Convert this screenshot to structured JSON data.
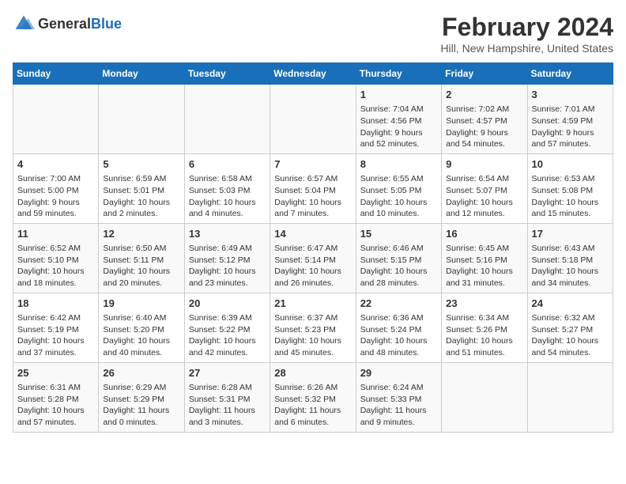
{
  "header": {
    "logo_general": "General",
    "logo_blue": "Blue",
    "title": "February 2024",
    "subtitle": "Hill, New Hampshire, United States"
  },
  "days_of_week": [
    "Sunday",
    "Monday",
    "Tuesday",
    "Wednesday",
    "Thursday",
    "Friday",
    "Saturday"
  ],
  "weeks": [
    [
      {
        "num": "",
        "detail": ""
      },
      {
        "num": "",
        "detail": ""
      },
      {
        "num": "",
        "detail": ""
      },
      {
        "num": "",
        "detail": ""
      },
      {
        "num": "1",
        "detail": "Sunrise: 7:04 AM\nSunset: 4:56 PM\nDaylight: 9 hours\nand 52 minutes."
      },
      {
        "num": "2",
        "detail": "Sunrise: 7:02 AM\nSunset: 4:57 PM\nDaylight: 9 hours\nand 54 minutes."
      },
      {
        "num": "3",
        "detail": "Sunrise: 7:01 AM\nSunset: 4:59 PM\nDaylight: 9 hours\nand 57 minutes."
      }
    ],
    [
      {
        "num": "4",
        "detail": "Sunrise: 7:00 AM\nSunset: 5:00 PM\nDaylight: 9 hours\nand 59 minutes."
      },
      {
        "num": "5",
        "detail": "Sunrise: 6:59 AM\nSunset: 5:01 PM\nDaylight: 10 hours\nand 2 minutes."
      },
      {
        "num": "6",
        "detail": "Sunrise: 6:58 AM\nSunset: 5:03 PM\nDaylight: 10 hours\nand 4 minutes."
      },
      {
        "num": "7",
        "detail": "Sunrise: 6:57 AM\nSunset: 5:04 PM\nDaylight: 10 hours\nand 7 minutes."
      },
      {
        "num": "8",
        "detail": "Sunrise: 6:55 AM\nSunset: 5:05 PM\nDaylight: 10 hours\nand 10 minutes."
      },
      {
        "num": "9",
        "detail": "Sunrise: 6:54 AM\nSunset: 5:07 PM\nDaylight: 10 hours\nand 12 minutes."
      },
      {
        "num": "10",
        "detail": "Sunrise: 6:53 AM\nSunset: 5:08 PM\nDaylight: 10 hours\nand 15 minutes."
      }
    ],
    [
      {
        "num": "11",
        "detail": "Sunrise: 6:52 AM\nSunset: 5:10 PM\nDaylight: 10 hours\nand 18 minutes."
      },
      {
        "num": "12",
        "detail": "Sunrise: 6:50 AM\nSunset: 5:11 PM\nDaylight: 10 hours\nand 20 minutes."
      },
      {
        "num": "13",
        "detail": "Sunrise: 6:49 AM\nSunset: 5:12 PM\nDaylight: 10 hours\nand 23 minutes."
      },
      {
        "num": "14",
        "detail": "Sunrise: 6:47 AM\nSunset: 5:14 PM\nDaylight: 10 hours\nand 26 minutes."
      },
      {
        "num": "15",
        "detail": "Sunrise: 6:46 AM\nSunset: 5:15 PM\nDaylight: 10 hours\nand 28 minutes."
      },
      {
        "num": "16",
        "detail": "Sunrise: 6:45 AM\nSunset: 5:16 PM\nDaylight: 10 hours\nand 31 minutes."
      },
      {
        "num": "17",
        "detail": "Sunrise: 6:43 AM\nSunset: 5:18 PM\nDaylight: 10 hours\nand 34 minutes."
      }
    ],
    [
      {
        "num": "18",
        "detail": "Sunrise: 6:42 AM\nSunset: 5:19 PM\nDaylight: 10 hours\nand 37 minutes."
      },
      {
        "num": "19",
        "detail": "Sunrise: 6:40 AM\nSunset: 5:20 PM\nDaylight: 10 hours\nand 40 minutes."
      },
      {
        "num": "20",
        "detail": "Sunrise: 6:39 AM\nSunset: 5:22 PM\nDaylight: 10 hours\nand 42 minutes."
      },
      {
        "num": "21",
        "detail": "Sunrise: 6:37 AM\nSunset: 5:23 PM\nDaylight: 10 hours\nand 45 minutes."
      },
      {
        "num": "22",
        "detail": "Sunrise: 6:36 AM\nSunset: 5:24 PM\nDaylight: 10 hours\nand 48 minutes."
      },
      {
        "num": "23",
        "detail": "Sunrise: 6:34 AM\nSunset: 5:26 PM\nDaylight: 10 hours\nand 51 minutes."
      },
      {
        "num": "24",
        "detail": "Sunrise: 6:32 AM\nSunset: 5:27 PM\nDaylight: 10 hours\nand 54 minutes."
      }
    ],
    [
      {
        "num": "25",
        "detail": "Sunrise: 6:31 AM\nSunset: 5:28 PM\nDaylight: 10 hours\nand 57 minutes."
      },
      {
        "num": "26",
        "detail": "Sunrise: 6:29 AM\nSunset: 5:29 PM\nDaylight: 11 hours\nand 0 minutes."
      },
      {
        "num": "27",
        "detail": "Sunrise: 6:28 AM\nSunset: 5:31 PM\nDaylight: 11 hours\nand 3 minutes."
      },
      {
        "num": "28",
        "detail": "Sunrise: 6:26 AM\nSunset: 5:32 PM\nDaylight: 11 hours\nand 6 minutes."
      },
      {
        "num": "29",
        "detail": "Sunrise: 6:24 AM\nSunset: 5:33 PM\nDaylight: 11 hours\nand 9 minutes."
      },
      {
        "num": "",
        "detail": ""
      },
      {
        "num": "",
        "detail": ""
      }
    ]
  ]
}
